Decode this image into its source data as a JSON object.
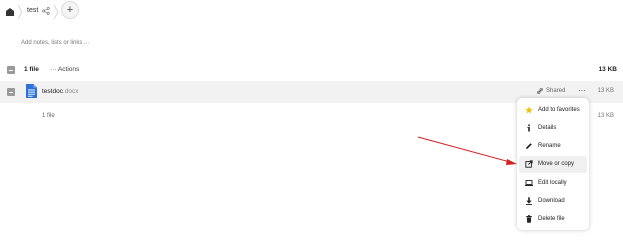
{
  "breadcrumb": {
    "folder": "test"
  },
  "notes": {
    "placeholder": "Add notes, lists or links ..."
  },
  "header": {
    "count": "1 file",
    "actions": "Actions",
    "size": "13 KB"
  },
  "file": {
    "name": "testdoc",
    "ext": ".docx",
    "shared_label": "Shared",
    "size": "13 KB"
  },
  "summary": {
    "count": "1 file",
    "size": "13 KB"
  },
  "menu": {
    "items": [
      {
        "label": "Add to favorites",
        "icon": "star-icon"
      },
      {
        "label": "Details",
        "icon": "info-icon"
      },
      {
        "label": "Rename",
        "icon": "pencil-icon"
      },
      {
        "label": "Move or copy",
        "icon": "move-copy-icon"
      },
      {
        "label": "Edit locally",
        "icon": "laptop-icon"
      },
      {
        "label": "Download",
        "icon": "download-icon"
      },
      {
        "label": "Delete file",
        "icon": "trash-icon"
      }
    ],
    "highlighted": "Move or copy"
  },
  "colors": {
    "star": "#f4c20d",
    "file_icon": "#2b73d6",
    "arrow": "#d42020",
    "row_bg": "#f2f2f2"
  }
}
